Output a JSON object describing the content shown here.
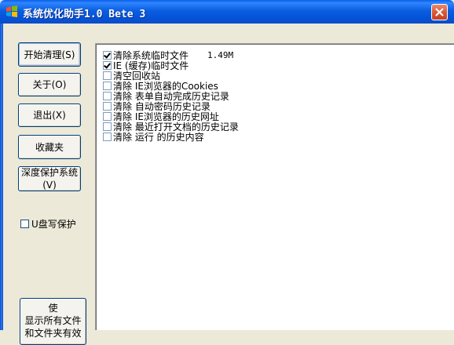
{
  "window": {
    "title": "系统优化助手1.0 Bete 3"
  },
  "sidebar": {
    "buttons": [
      "开始清理(S)",
      "关于(O)",
      "退出(X)",
      "收藏夹",
      "深度保护系统(V)"
    ],
    "usb_protect": {
      "label": "U盘写保护",
      "checked": false
    },
    "bottom_button": "使\n显示所有文件和文件夹有效"
  },
  "cleanup": {
    "items": [
      {
        "label": "清除系统临时文件",
        "checked": true,
        "size": "1.49M"
      },
      {
        "label": "IE (缓存)临时文件",
        "checked": true
      },
      {
        "label": "清空回收站",
        "checked": false
      },
      {
        "label": "清除 IE浏览器的Cookies",
        "checked": false
      },
      {
        "label": "清除 表单自动完成历史记录",
        "checked": false
      },
      {
        "label": "清除 自动密码历史记录",
        "checked": false
      },
      {
        "label": "清除 IE浏览器的历史网址",
        "checked": false
      },
      {
        "label": "清除 最近打开文档的历史记录",
        "checked": false
      },
      {
        "label": "清除 运行 的历史内容",
        "checked": false
      }
    ]
  }
}
